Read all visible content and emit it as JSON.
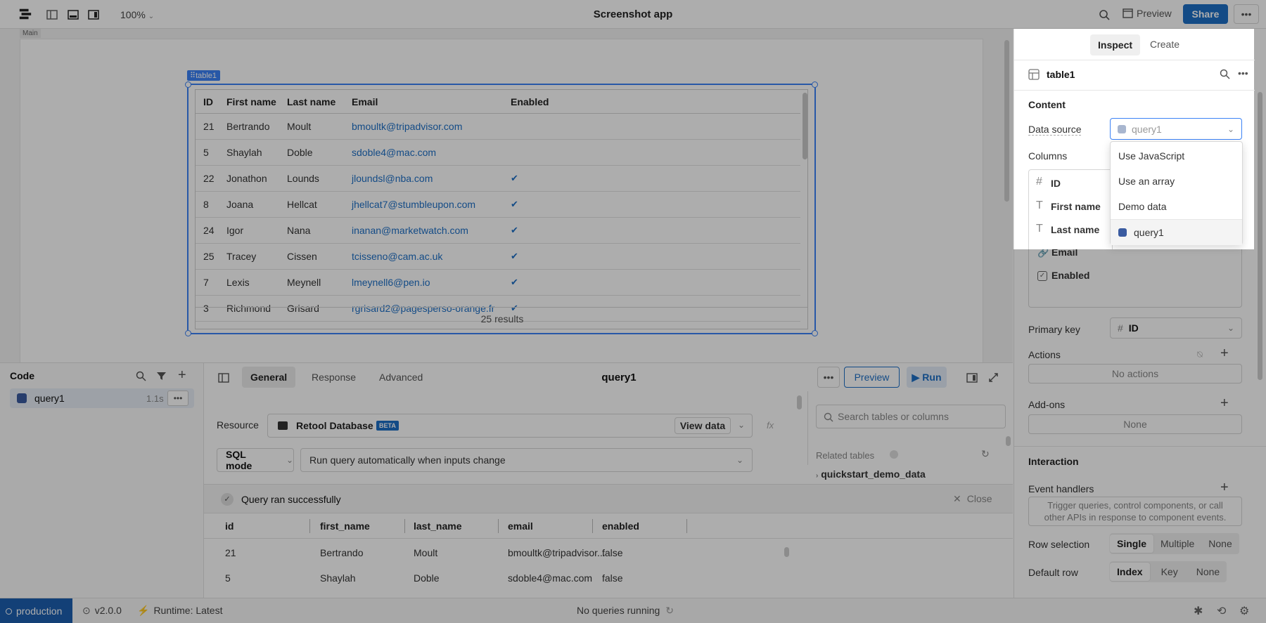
{
  "app": {
    "title": "Screenshot app",
    "zoom": "100%"
  },
  "topbar": {
    "preview_label": "Preview",
    "share_label": "Share"
  },
  "canvas": {
    "frame_label": "Main",
    "table_tag": "table1"
  },
  "table": {
    "columns": [
      "ID",
      "First name",
      "Last name",
      "Email",
      "Enabled"
    ],
    "rows": [
      {
        "id": "21",
        "first": "Bertrando",
        "last": "Moult",
        "email": "bmoultk@tripadvisor.com",
        "enabled": ""
      },
      {
        "id": "5",
        "first": "Shaylah",
        "last": "Doble",
        "email": "sdoble4@mac.com",
        "enabled": ""
      },
      {
        "id": "22",
        "first": "Jonathon",
        "last": "Lounds",
        "email": "jloundsl@nba.com",
        "enabled": "✔"
      },
      {
        "id": "8",
        "first": "Joana",
        "last": "Hellcat",
        "email": "jhellcat7@stumbleupon.com",
        "enabled": "✔"
      },
      {
        "id": "24",
        "first": "Igor",
        "last": "Nana",
        "email": "inanan@marketwatch.com",
        "enabled": "✔"
      },
      {
        "id": "25",
        "first": "Tracey",
        "last": "Cissen",
        "email": "tcisseno@cam.ac.uk",
        "enabled": "✔"
      },
      {
        "id": "7",
        "first": "Lexis",
        "last": "Meynell",
        "email": "lmeynell6@pen.io",
        "enabled": "✔"
      },
      {
        "id": "3",
        "first": "Richmond",
        "last": "Grisard",
        "email": "rgrisard2@pagesperso-orange.fr",
        "enabled": "✔"
      }
    ],
    "footer": "25 results"
  },
  "inspector": {
    "tabs": [
      "Inspect",
      "Create"
    ],
    "component_name": "table1",
    "content_heading": "Content",
    "data_source_label": "Data source",
    "data_source_value": "query1",
    "columns_label": "Columns",
    "columns": [
      {
        "name": "ID",
        "icon": "hash-icon"
      },
      {
        "name": "First name",
        "icon": "text-icon"
      },
      {
        "name": "Last name",
        "icon": "text-icon"
      },
      {
        "name": "Email",
        "icon": "link-icon"
      },
      {
        "name": "Enabled",
        "icon": "checkbox-icon"
      }
    ],
    "primary_key_label": "Primary key",
    "primary_key_value": "ID",
    "actions_label": "Actions",
    "actions_value": "No actions",
    "addons_label": "Add-ons",
    "addons_value": "None",
    "interaction_heading": "Interaction",
    "event_handlers_label": "Event handlers",
    "event_handlers_text": "Trigger queries, control components, or call other APIs in response to component events.",
    "row_selection_label": "Row selection",
    "row_selection_options": [
      "Single",
      "Multiple",
      "None"
    ],
    "default_row_label": "Default row",
    "default_row_options": [
      "Index",
      "Key",
      "None"
    ],
    "dropdown_options": [
      "Use JavaScript",
      "Use an array",
      "Demo data",
      "query1"
    ]
  },
  "code": {
    "heading": "Code",
    "query_name": "query1",
    "query_time": "1.1s"
  },
  "editor": {
    "tabs": [
      "General",
      "Response",
      "Advanced"
    ],
    "title": "query1",
    "preview_label": "Preview",
    "run_label": "Run",
    "resource_label": "Resource",
    "resource_value": "Retool Database",
    "beta_badge": "BETA",
    "view_data_label": "View data",
    "mode_value": "SQL mode",
    "trigger_value": "Run query automatically when inputs change",
    "search_placeholder": "Search tables or columns",
    "related_tables_label": "Related tables",
    "related_table": "quickstart_demo_data",
    "status_text": "Query ran successfully",
    "close_label": "Close",
    "result_columns": [
      "id",
      "first_name",
      "last_name",
      "email",
      "enabled"
    ],
    "result_rows": [
      [
        "21",
        "Bertrando",
        "Moult",
        "bmoultk@tripadvisor...",
        "false"
      ],
      [
        "5",
        "Shaylah",
        "Doble",
        "sdoble4@mac.com",
        "false"
      ]
    ]
  },
  "status": {
    "env": "production",
    "version": "v2.0.0",
    "runtime": "Runtime: Latest",
    "queries": "No queries running"
  },
  "colors": {
    "accent": "#1d6fc6",
    "env": "#1d5fb0"
  }
}
